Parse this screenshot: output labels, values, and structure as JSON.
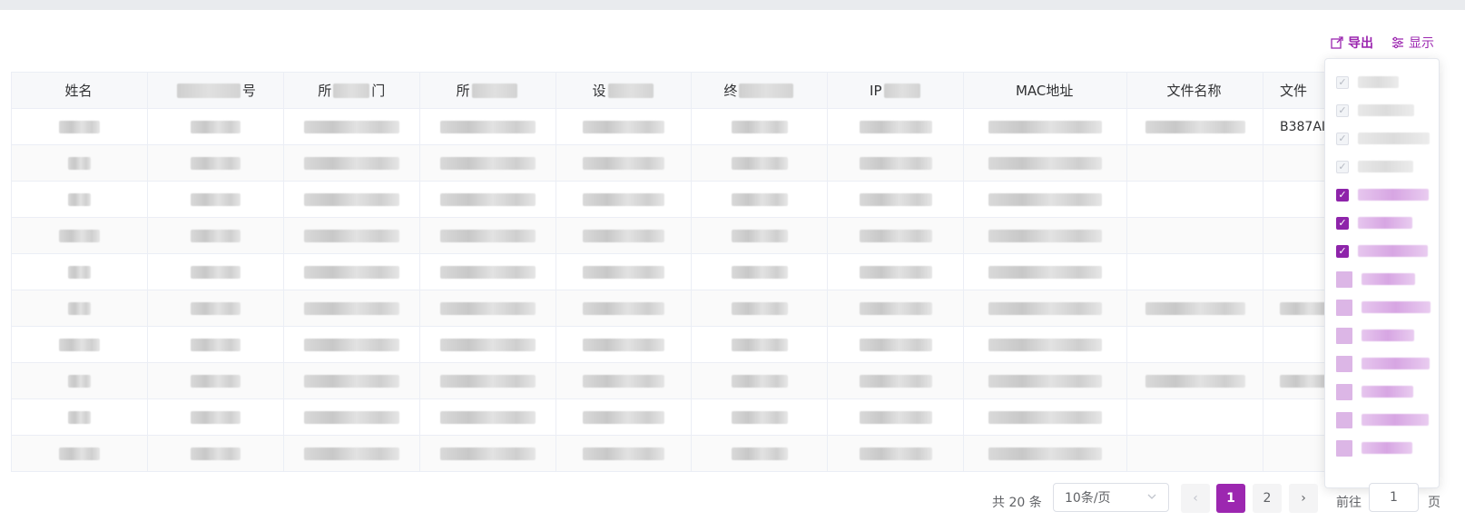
{
  "toolbar": {
    "export_label": "导出",
    "display_label": "显示"
  },
  "table": {
    "headers": [
      {
        "prefix": "姓名",
        "suffix": ""
      },
      {
        "prefix": "",
        "suffix": "号"
      },
      {
        "prefix": "所",
        "suffix": "门"
      },
      {
        "prefix": "所",
        "suffix": ""
      },
      {
        "prefix": "设",
        "suffix": ""
      },
      {
        "prefix": "终",
        "suffix": ""
      },
      {
        "prefix": "IP",
        "suffix": ""
      },
      {
        "prefix": "MAC地址",
        "suffix": ""
      },
      {
        "prefix": "文件名称",
        "suffix": ""
      },
      {
        "prefix": "文件",
        "suffix": ""
      }
    ],
    "first_row_file_fragment": "B387AI",
    "row_count": 10
  },
  "column_picker": {
    "options": [
      {
        "state": "disabled"
      },
      {
        "state": "disabled"
      },
      {
        "state": "disabled"
      },
      {
        "state": "disabled"
      },
      {
        "state": "checked"
      },
      {
        "state": "checked"
      },
      {
        "state": "checked"
      },
      {
        "state": "unchecked"
      },
      {
        "state": "unchecked"
      },
      {
        "state": "unchecked"
      },
      {
        "state": "unchecked"
      },
      {
        "state": "unchecked"
      },
      {
        "state": "unchecked"
      },
      {
        "state": "unchecked"
      }
    ]
  },
  "pagination": {
    "total_text": "共 20 条",
    "page_size": "10条/页",
    "pages": [
      "1",
      "2"
    ],
    "current_page": "1",
    "prev_icon": "‹",
    "next_icon": "›",
    "goto_label": "前往",
    "goto_value": "1",
    "page_suffix": "页"
  },
  "colors": {
    "accent": "#9c27b0",
    "accent_light": "#dcb6e6",
    "header_bg": "#f7f8fa",
    "border": "#ebeef5"
  }
}
